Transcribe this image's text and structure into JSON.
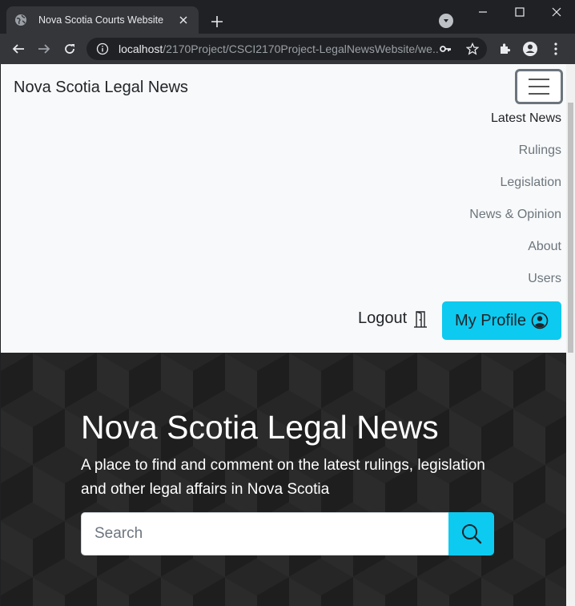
{
  "browser": {
    "tab_title": "Nova Scotia Courts Website",
    "url_host": "localhost",
    "url_path": "/2170Project/CSCI2170Project-LegalNewsWebsite/we...",
    "icons": [
      "globe-icon",
      "close-icon",
      "plus-icon",
      "tab-search-icon",
      "minimize-icon",
      "maximize-icon",
      "window-close-icon",
      "back-icon",
      "forward-icon",
      "reload-icon",
      "info-icon",
      "key-icon",
      "star-icon",
      "extensions-icon",
      "profile-icon",
      "menu-icon"
    ]
  },
  "navbar": {
    "brand": "Nova Scotia Legal News",
    "items": [
      {
        "label": "Latest News",
        "active": true
      },
      {
        "label": "Rulings",
        "active": false
      },
      {
        "label": "Legislation",
        "active": false
      },
      {
        "label": "News & Opinion",
        "active": false
      },
      {
        "label": "About",
        "active": false
      },
      {
        "label": "Users",
        "active": false
      }
    ],
    "logout_label": "Logout",
    "profile_label": "My Profile",
    "accent_color": "#0dcaf0"
  },
  "hero": {
    "title": "Nova Scotia Legal News",
    "subtitle": "A place to find and comment on the latest rulings, legislation and other legal affairs in Nova Scotia",
    "search_placeholder": "Search",
    "search_value": ""
  }
}
